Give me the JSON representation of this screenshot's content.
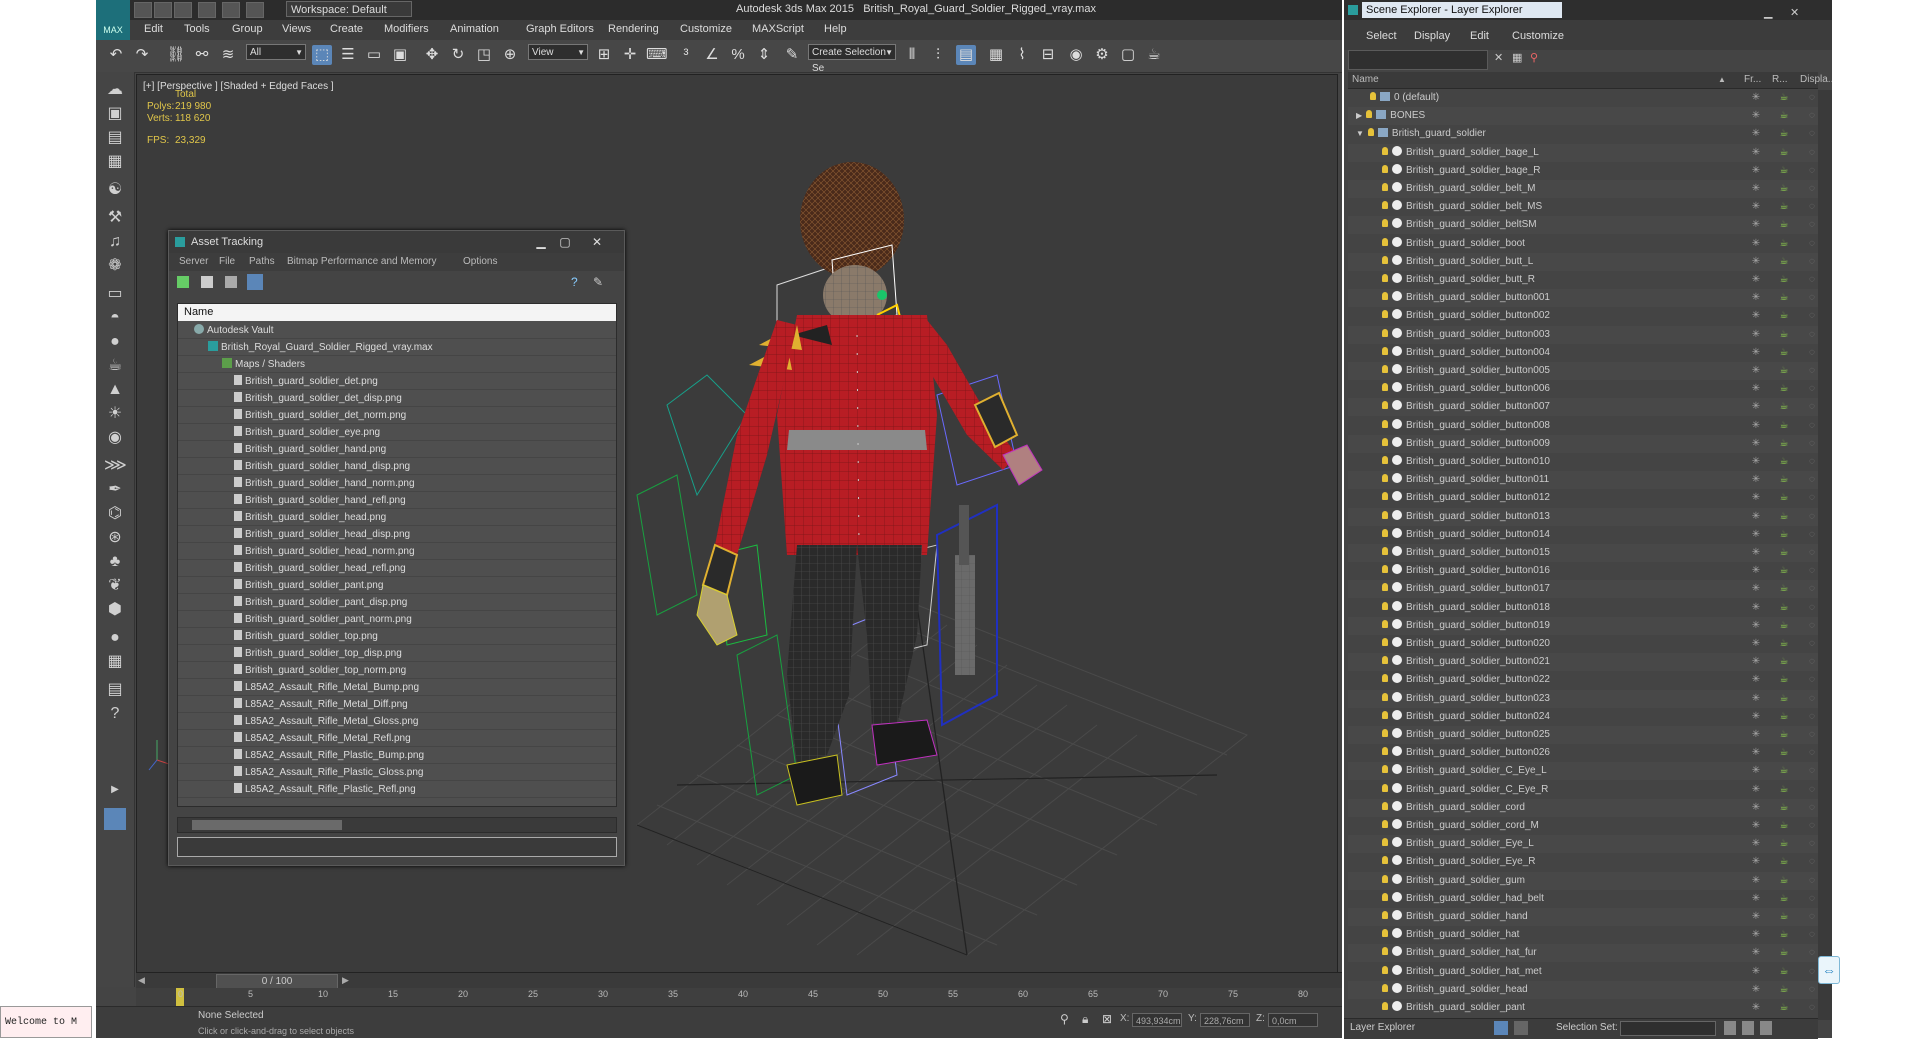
{
  "app": {
    "title_prefix": "Autodesk 3ds Max 2015",
    "file_name": "British_Royal_Guard_Soldier_Rigged_vray.max",
    "logo_text": "MAX",
    "workspace": "Workspace: Default"
  },
  "menu": [
    "Edit",
    "Tools",
    "Group",
    "Views",
    "Create",
    "Modifiers",
    "Animation",
    "Graph Editors",
    "Rendering",
    "Customize",
    "MAXScript",
    "Help"
  ],
  "toolbar": {
    "filter_select": "All",
    "view_select": "View",
    "selection_set": "Create Selection Se"
  },
  "viewport": {
    "label": "[+] [Perspective ] [Shaded + Edged Faces ]",
    "stats_header": "Total",
    "polys_label": "Polys:",
    "polys_value": "219 980",
    "verts_label": "Verts:",
    "verts_value": "118 620",
    "fps_label": "FPS:",
    "fps_value": "23,329"
  },
  "asset_tracking": {
    "title": "Asset Tracking",
    "menu": [
      "Server",
      "File",
      "Paths",
      "Bitmap Performance and Memory",
      "Options"
    ],
    "column_header": "Name",
    "vault": "Autodesk Vault",
    "scene_file": "British_Royal_Guard_Soldier_Rigged_vray.max",
    "maps_folder": "Maps / Shaders",
    "files": [
      "British_guard_soldier_det.png",
      "British_guard_soldier_det_disp.png",
      "British_guard_soldier_det_norm.png",
      "British_guard_soldier_eye.png",
      "British_guard_soldier_hand.png",
      "British_guard_soldier_hand_disp.png",
      "British_guard_soldier_hand_norm.png",
      "British_guard_soldier_hand_refl.png",
      "British_guard_soldier_head.png",
      "British_guard_soldier_head_disp.png",
      "British_guard_soldier_head_norm.png",
      "British_guard_soldier_head_refl.png",
      "British_guard_soldier_pant.png",
      "British_guard_soldier_pant_disp.png",
      "British_guard_soldier_pant_norm.png",
      "British_guard_soldier_top.png",
      "British_guard_soldier_top_disp.png",
      "British_guard_soldier_top_norm.png",
      "L85A2_Assault_Rifle_Metal_Bump.png",
      "L85A2_Assault_Rifle_Metal_Diff.png",
      "L85A2_Assault_Rifle_Metal_Gloss.png",
      "L85A2_Assault_Rifle_Metal_Refl.png",
      "L85A2_Assault_Rifle_Plastic_Bump.png",
      "L85A2_Assault_Rifle_Plastic_Gloss.png",
      "L85A2_Assault_Rifle_Plastic_Refl.png"
    ]
  },
  "timeline": {
    "frame": "0 / 100",
    "ticks": [
      "0",
      "5",
      "10",
      "15",
      "20",
      "25",
      "30",
      "35",
      "40",
      "45",
      "50",
      "55",
      "60",
      "65",
      "70",
      "75",
      "80"
    ]
  },
  "status": {
    "welcome": "Welcome to M",
    "selection": "None Selected",
    "prompt": "Click or click-and-drag to select objects",
    "x_label": "X:",
    "x_value": "493,934cm",
    "y_label": "Y:",
    "y_value": "228,76cm",
    "z_label": "Z:",
    "z_value": "0,0cm"
  },
  "scene_explorer": {
    "title": "Scene Explorer - Layer Explorer",
    "menu": [
      "Select",
      "Display",
      "Edit",
      "Customize"
    ],
    "col_name": "Name",
    "col_freeze": "Fr...",
    "col_render": "R...",
    "col_display": "Displa...",
    "layers": [
      "0 (default)",
      "BONES",
      "British_guard_soldier"
    ],
    "objects": [
      "British_guard_soldier_bage_L",
      "British_guard_soldier_bage_R",
      "British_guard_soldier_belt_M",
      "British_guard_soldier_belt_MS",
      "British_guard_soldier_beltSM",
      "British_guard_soldier_boot",
      "British_guard_soldier_butt_L",
      "British_guard_soldier_butt_R",
      "British_guard_soldier_button001",
      "British_guard_soldier_button002",
      "British_guard_soldier_button003",
      "British_guard_soldier_button004",
      "British_guard_soldier_button005",
      "British_guard_soldier_button006",
      "British_guard_soldier_button007",
      "British_guard_soldier_button008",
      "British_guard_soldier_button009",
      "British_guard_soldier_button010",
      "British_guard_soldier_button011",
      "British_guard_soldier_button012",
      "British_guard_soldier_button013",
      "British_guard_soldier_button014",
      "British_guard_soldier_button015",
      "British_guard_soldier_button016",
      "British_guard_soldier_button017",
      "British_guard_soldier_button018",
      "British_guard_soldier_button019",
      "British_guard_soldier_button020",
      "British_guard_soldier_button021",
      "British_guard_soldier_button022",
      "British_guard_soldier_button023",
      "British_guard_soldier_button024",
      "British_guard_soldier_button025",
      "British_guard_soldier_button026",
      "British_guard_soldier_C_Eye_L",
      "British_guard_soldier_C_Eye_R",
      "British_guard_soldier_cord",
      "British_guard_soldier_cord_M",
      "British_guard_soldier_Eye_L",
      "British_guard_soldier_Eye_R",
      "British_guard_soldier_gum",
      "British_guard_soldier_had_belt",
      "British_guard_soldier_hand",
      "British_guard_soldier_hat",
      "British_guard_soldier_hat_fur",
      "British_guard_soldier_hat_met",
      "British_guard_soldier_head",
      "British_guard_soldier_pant"
    ],
    "bottom_label": "Layer Explorer",
    "selection_set_label": "Selection Set:"
  },
  "colors": {
    "accent": "#5b86b8",
    "uniform_red": "#b81d24",
    "fur": "#4a2a1a",
    "stats_yellow": "#e0c64a"
  }
}
